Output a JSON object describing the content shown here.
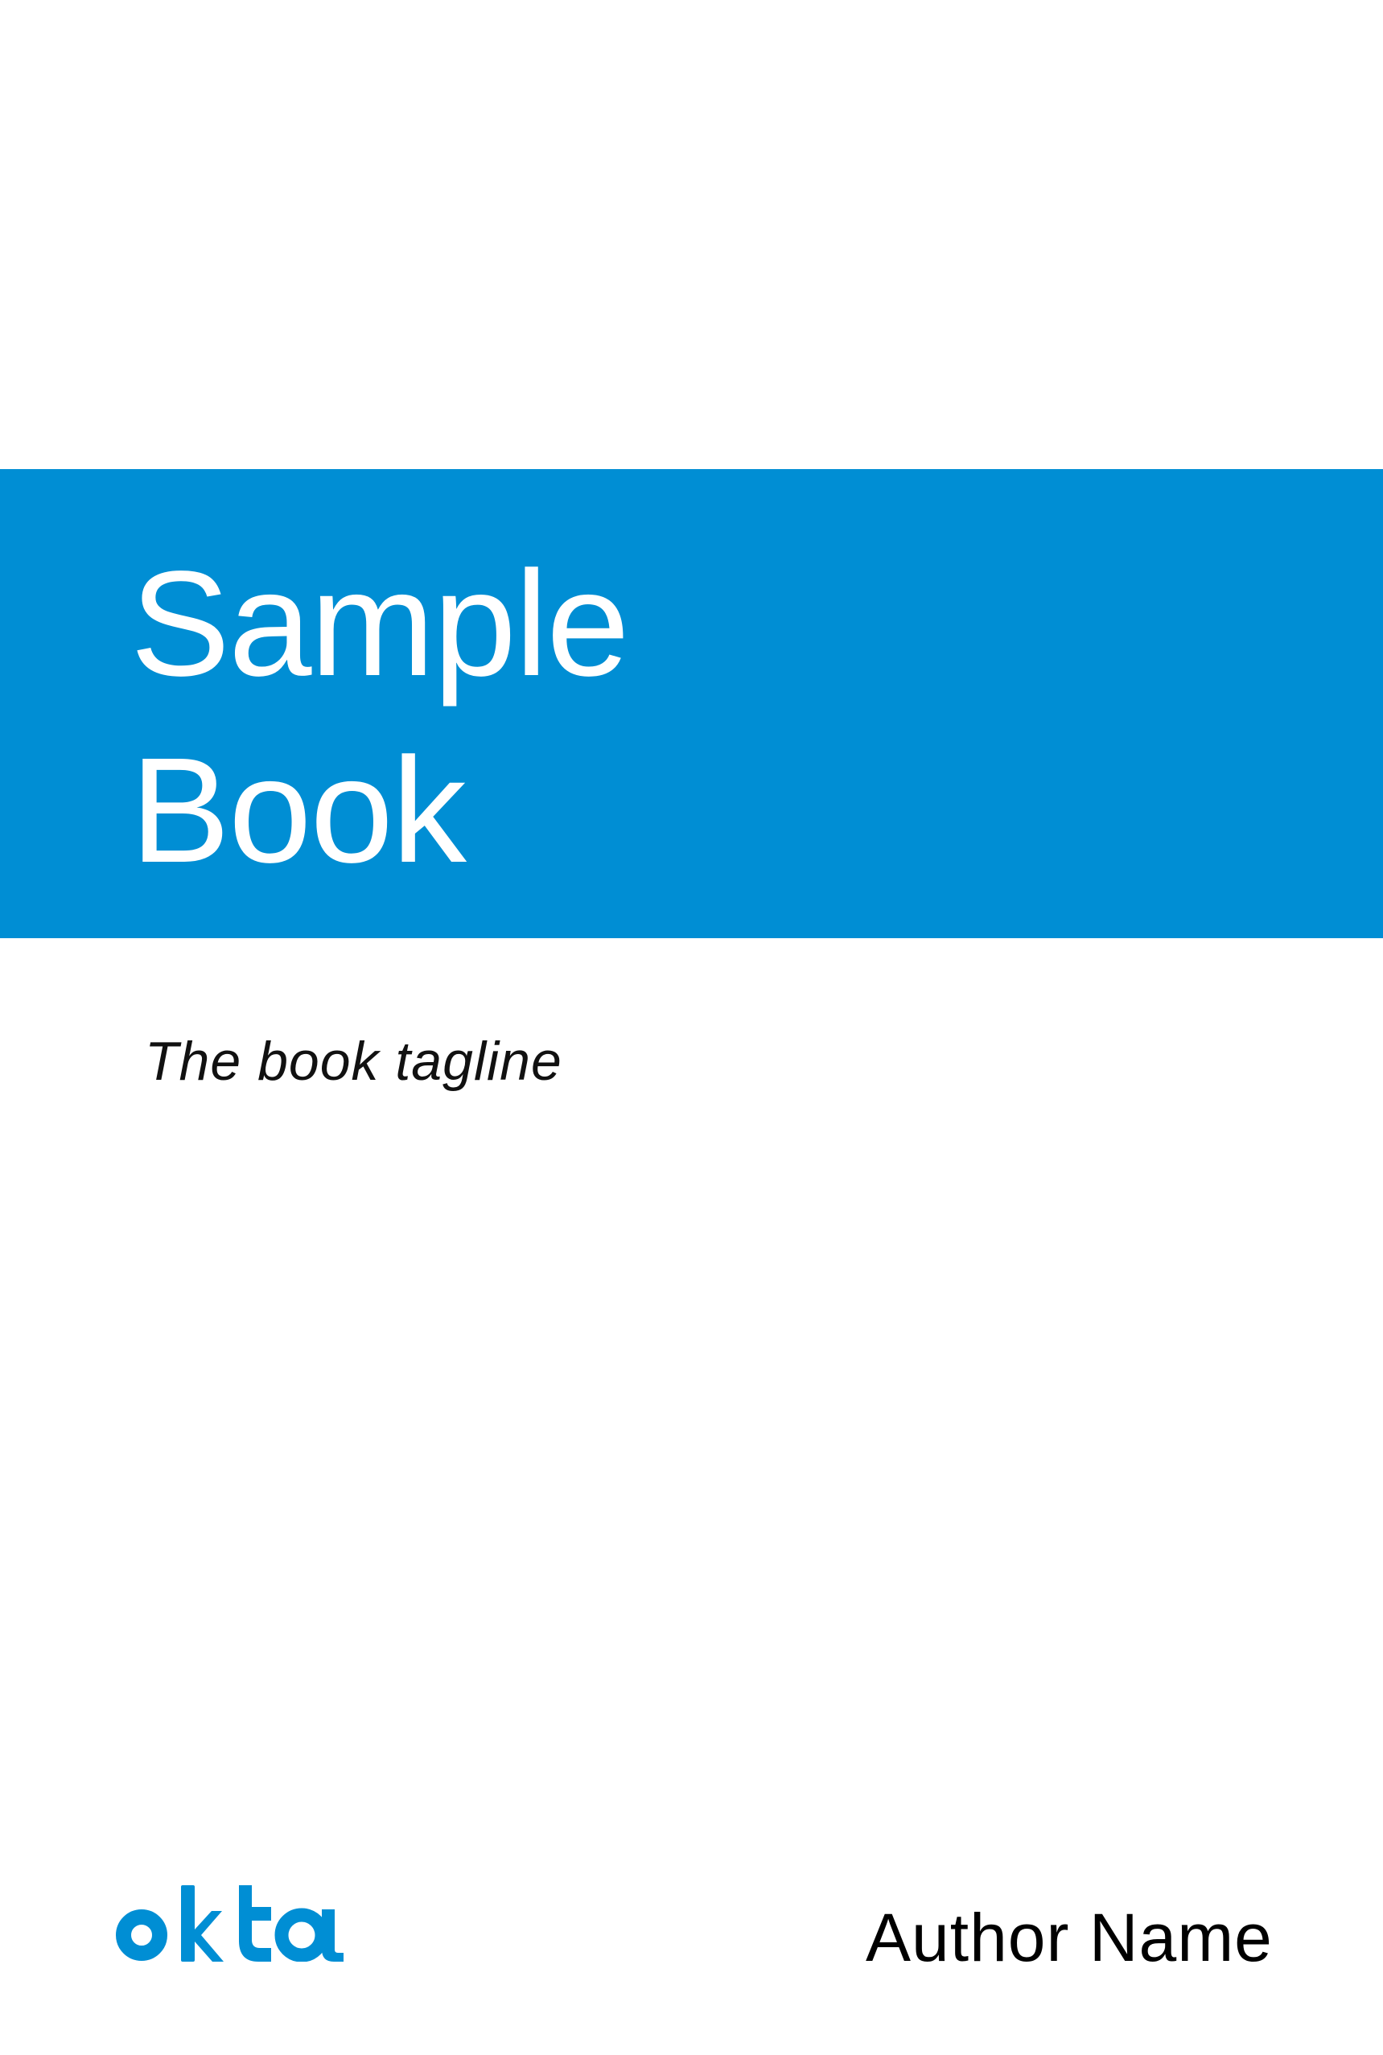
{
  "cover": {
    "title_line1": "Sample",
    "title_line2": "Book",
    "tagline": "The book tagline",
    "author": "Author Name",
    "logo_text": "okta"
  },
  "colors": {
    "brand_blue": "#008ED4",
    "text": "#000000",
    "background": "#FFFFFF"
  }
}
